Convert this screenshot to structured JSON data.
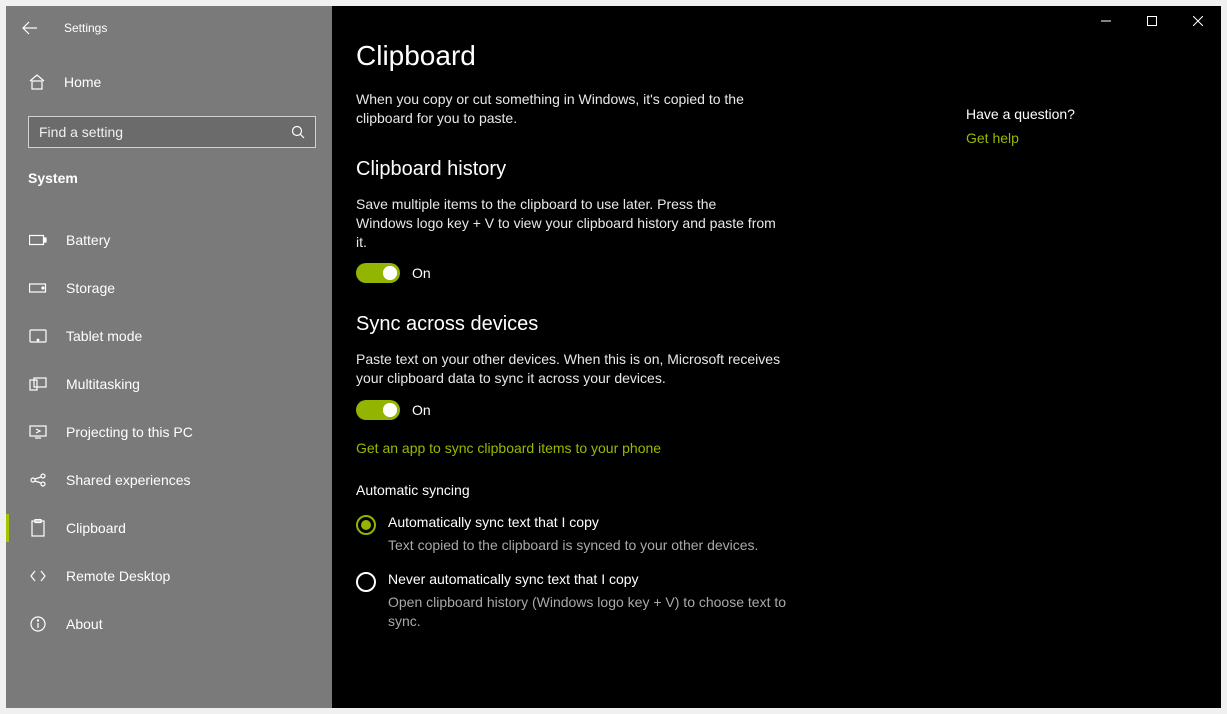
{
  "titlebar": {
    "app_title": "Settings"
  },
  "sidebar": {
    "home_label": "Home",
    "search_placeholder": "Find a setting",
    "category_label": "System",
    "items": [
      {
        "label": "Battery"
      },
      {
        "label": "Storage"
      },
      {
        "label": "Tablet mode"
      },
      {
        "label": "Multitasking"
      },
      {
        "label": "Projecting to this PC"
      },
      {
        "label": "Shared experiences"
      },
      {
        "label": "Clipboard"
      },
      {
        "label": "Remote Desktop"
      },
      {
        "label": "About"
      }
    ]
  },
  "main": {
    "page_title": "Clipboard",
    "intro": "When you copy or cut something in Windows, it's copied to the clipboard for you to paste.",
    "history": {
      "heading": "Clipboard history",
      "desc": "Save multiple items to the clipboard to use later. Press the Windows logo key + V to view your clipboard history and paste from it.",
      "toggle_state": "On"
    },
    "sync": {
      "heading": "Sync across devices",
      "desc": "Paste text on your other devices. When this is on, Microsoft receives your clipboard data to sync it across your devices.",
      "toggle_state": "On",
      "app_link": "Get an app to sync clipboard items to your phone",
      "auto_label": "Automatic syncing",
      "options": [
        {
          "title": "Automatically sync text that I copy",
          "desc": "Text copied to the clipboard is synced to your other devices."
        },
        {
          "title": "Never automatically sync text that I copy",
          "desc": "Open clipboard history (Windows logo key + V) to choose text to sync."
        }
      ]
    }
  },
  "help": {
    "question": "Have a question?",
    "link": "Get help"
  }
}
